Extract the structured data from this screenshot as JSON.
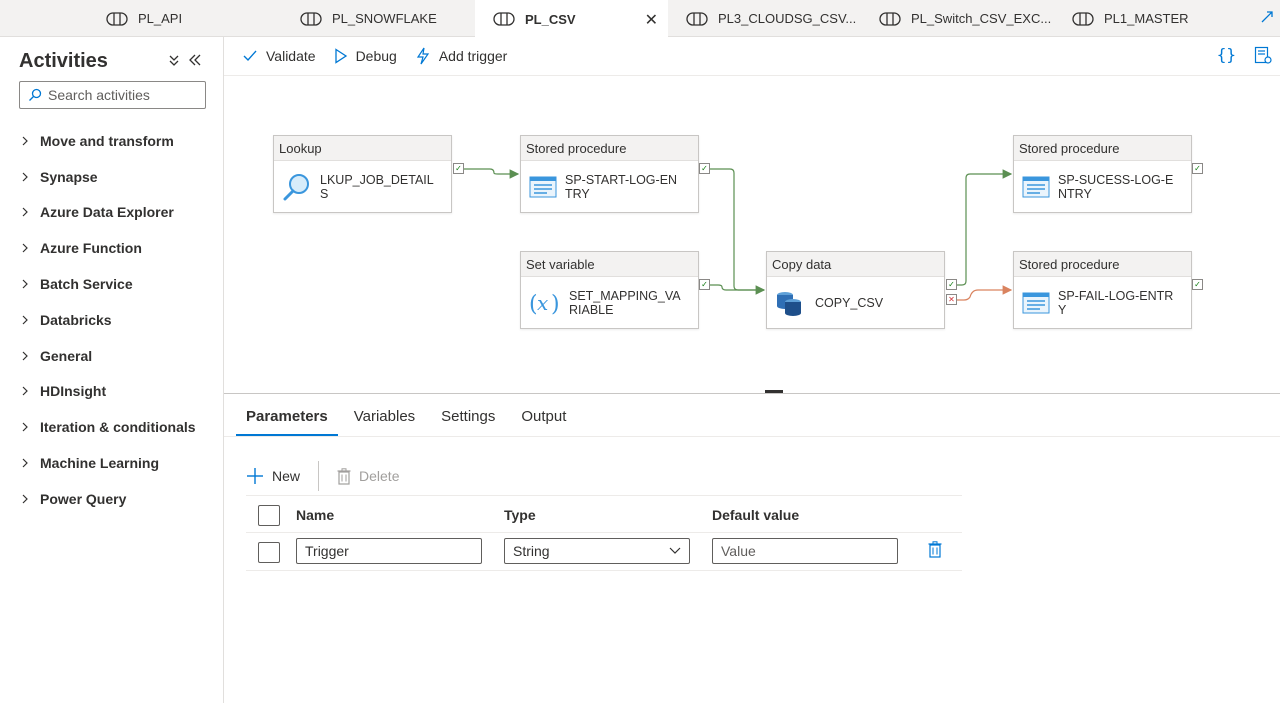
{
  "tabs": [
    {
      "label": "PL_API",
      "active": false
    },
    {
      "label": "PL_SNOWFLAKE",
      "active": false
    },
    {
      "label": "PL_CSV",
      "active": true
    },
    {
      "label": "PL3_CLOUDSG_CSV...",
      "active": false
    },
    {
      "label": "PL_Switch_CSV_EXC...",
      "active": false
    },
    {
      "label": "PL1_MASTER",
      "active": false
    }
  ],
  "tab_close_glyph": "✕",
  "activities_panel": {
    "title": "Activities",
    "search_placeholder": "Search activities",
    "categories": [
      "Move and transform",
      "Synapse",
      "Azure Data Explorer",
      "Azure Function",
      "Batch Service",
      "Databricks",
      "General",
      "HDInsight",
      "Iteration & conditionals",
      "Machine Learning",
      "Power Query"
    ]
  },
  "toolbar": {
    "validate_label": "Validate",
    "debug_label": "Debug",
    "add_trigger_label": "Add trigger",
    "code_glyph": "{}"
  },
  "pipeline": {
    "activities": [
      {
        "type": "Lookup",
        "name": "LKUP_JOB_DETAILS",
        "icon": "lookup-icon"
      },
      {
        "type": "Stored procedure",
        "name": "SP-START-LOG-ENTRY",
        "icon": "stored-procedure-icon"
      },
      {
        "type": "Set variable",
        "name": "SET_MAPPING_VARIABLE",
        "icon": "variable-icon"
      },
      {
        "type": "Copy data",
        "name": "COPY_CSV",
        "icon": "copy-data-icon"
      },
      {
        "type": "Stored procedure",
        "name": "SP-SUCESS-LOG-ENTRY",
        "icon": "stored-procedure-icon"
      },
      {
        "type": "Stored procedure",
        "name": "SP-FAIL-LOG-ENTRY",
        "icon": "stored-procedure-icon"
      }
    ],
    "colors": {
      "success": "#107c10",
      "failure": "#d13438",
      "connector_success": "#5b8f52",
      "connector_failure": "#d9835f"
    }
  },
  "bottom_panel": {
    "tabs": [
      "Parameters",
      "Variables",
      "Settings",
      "Output"
    ],
    "new_label": "New",
    "delete_label": "Delete",
    "columns": {
      "name": "Name",
      "type": "Type",
      "default": "Default value"
    },
    "parameters": [
      {
        "name": "Trigger",
        "type": "String",
        "default_placeholder": "Value"
      }
    ]
  },
  "accent_color": "#0078d4"
}
